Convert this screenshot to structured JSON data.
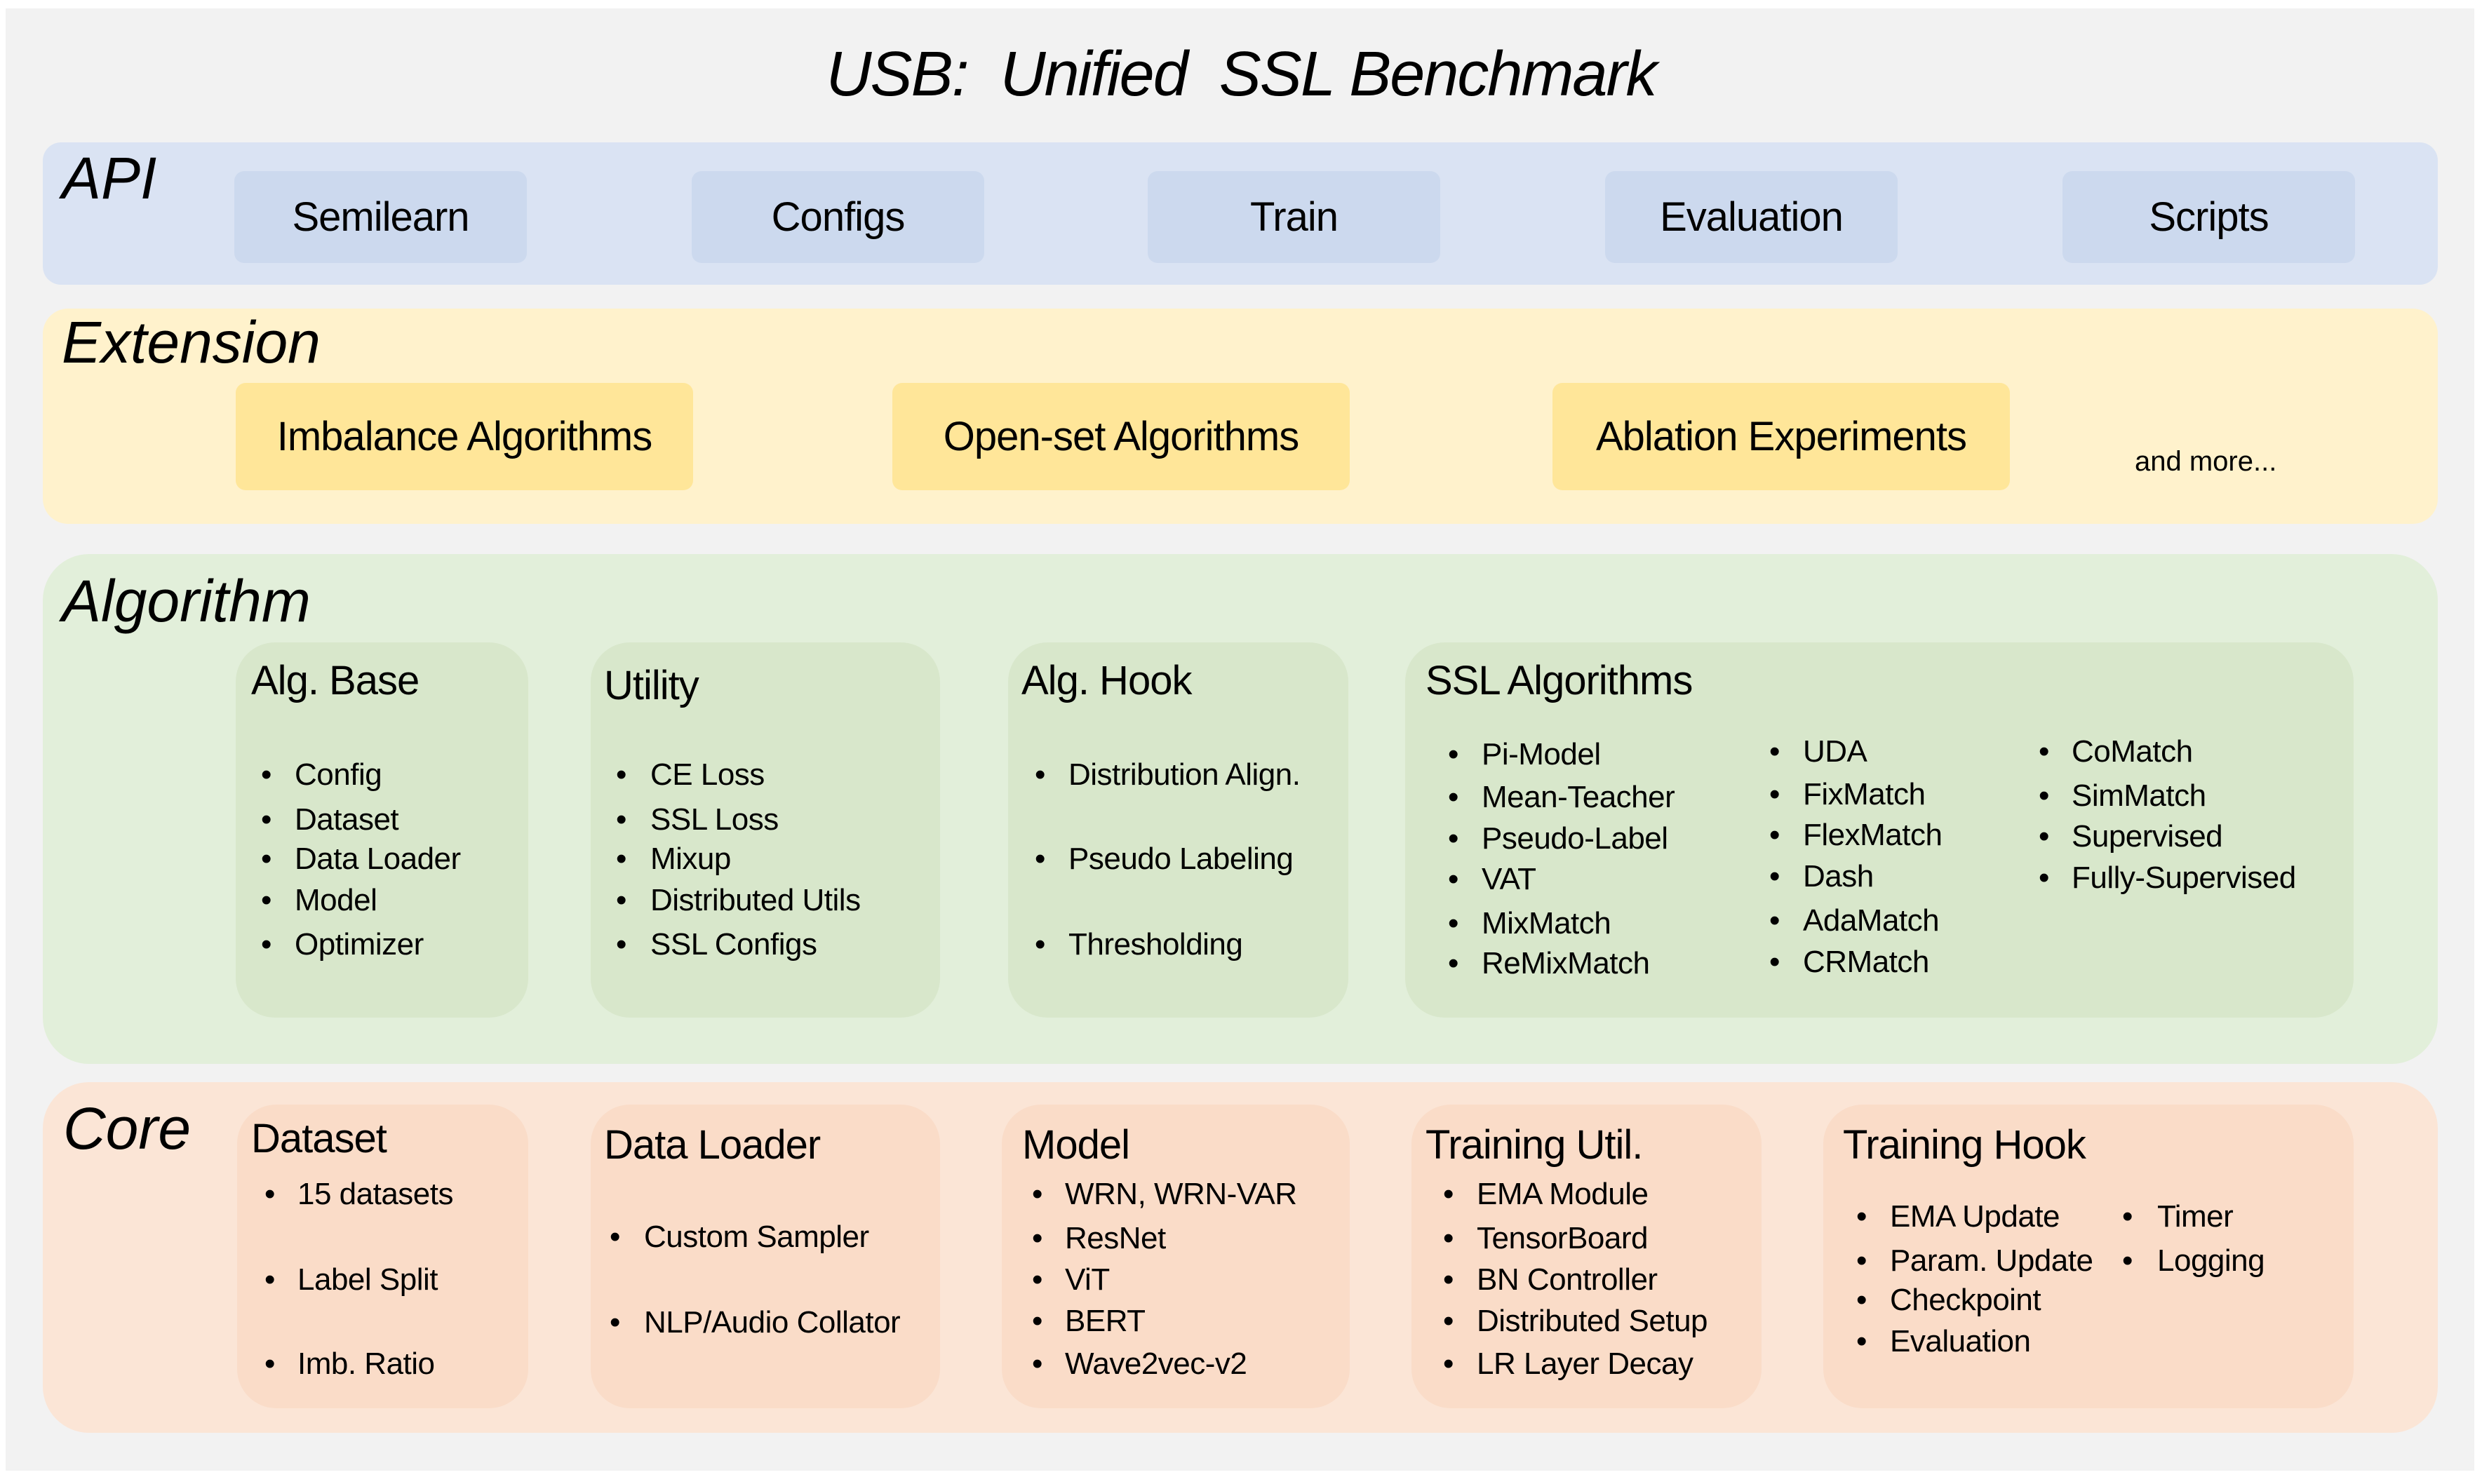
{
  "title": "USB:  Unified  SSL Benchmark",
  "colors": {
    "background": "#F2F2F2",
    "api_band": "#DAE3F3",
    "api_box": "#CCD9EE",
    "extension_band": "#FFF2CC",
    "extension_box": "#FFE699",
    "algorithm_band": "#E2EFDA",
    "algorithm_box": "#D8E7CB",
    "core_band": "#FBE5D6",
    "core_box": "#FADCC8"
  },
  "bullet_glyph": "•",
  "layers": {
    "api": {
      "label": "API",
      "items": [
        "Semilearn",
        "Configs",
        "Train",
        "Evaluation",
        "Scripts"
      ]
    },
    "extension": {
      "label": "Extension",
      "items": [
        "Imbalance  Algorithms",
        "Open-set  Algorithms",
        "Ablation Experiments"
      ],
      "more": "and more..."
    },
    "algorithm": {
      "label": "Algorithm",
      "modules": [
        {
          "title": "Alg. Base",
          "items": [
            "Config",
            "Dataset",
            "Data Loader",
            "Model",
            "Optimizer"
          ]
        },
        {
          "title": "Utility",
          "items": [
            "CE Loss",
            "SSL Loss",
            "Mixup",
            "Distributed Utils",
            "SSL Configs"
          ]
        },
        {
          "title": "Alg. Hook",
          "items": [
            "Distribution Align.",
            "Pseudo Labeling",
            "Thresholding"
          ]
        },
        {
          "title": "SSL Algorithms",
          "columns": [
            [
              "Pi-Model",
              "Mean-Teacher",
              "Pseudo-Label",
              "VAT",
              "MixMatch",
              "ReMixMatch"
            ],
            [
              "UDA",
              "FixMatch",
              "FlexMatch",
              "Dash",
              "AdaMatch",
              "CRMatch"
            ],
            [
              "CoMatch",
              "SimMatch",
              "Supervised",
              "Fully-Supervised"
            ]
          ]
        }
      ]
    },
    "core": {
      "label": "Core",
      "modules": [
        {
          "title": "Dataset",
          "items": [
            "15 datasets",
            "Label Split",
            "Imb.  Ratio"
          ]
        },
        {
          "title": "Data Loader",
          "items": [
            "Custom Sampler",
            "NLP/Audio Collator"
          ]
        },
        {
          "title": "Model",
          "items": [
            "WRN, WRN-VAR",
            "ResNet",
            "ViT",
            "BERT",
            "Wave2vec-v2"
          ]
        },
        {
          "title": "Training Util.",
          "items": [
            "EMA Module",
            "TensorBoard",
            "BN Controller",
            "Distributed Setup",
            "LR Layer Decay"
          ]
        },
        {
          "title": "Training Hook",
          "columns": [
            [
              "EMA Update",
              "Param. Update",
              "Checkpoint",
              "Evaluation"
            ],
            [
              "Timer",
              "Logging"
            ]
          ]
        }
      ]
    }
  }
}
